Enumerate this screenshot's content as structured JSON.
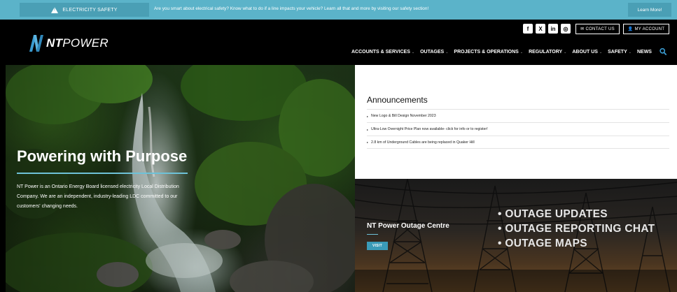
{
  "alert": {
    "label": "ELECTRICITY SAFETY",
    "message": "Are you smart about electrical safety? Know what to do if a line impacts your vehicle? Learn all that and more by visiting our safety section!",
    "button": "Learn More!"
  },
  "logo": {
    "n": "N",
    "bold": "NT",
    "light": "POWER"
  },
  "header": {
    "socials": [
      "facebook-icon",
      "x-twitter-icon",
      "linkedin-icon",
      "instagram-icon"
    ],
    "contact_label": "CONTACT US",
    "account_label": "MY ACCOUNT"
  },
  "nav": {
    "items": [
      {
        "label": "ACCOUNTS & SERVICES",
        "dropdown": true
      },
      {
        "label": "OUTAGES",
        "dropdown": true
      },
      {
        "label": "PROJECTS & OPERATIONS",
        "dropdown": true
      },
      {
        "label": "REGULATORY",
        "dropdown": true
      },
      {
        "label": "ABOUT US",
        "dropdown": true
      },
      {
        "label": "SAFETY",
        "dropdown": true
      },
      {
        "label": "NEWS",
        "dropdown": false
      }
    ],
    "chevron": "⌄"
  },
  "hero": {
    "title": "Powering with Purpose",
    "text": "NT Power is an Ontario Energy Board licensed electricity Local Distribution Company. We are an independent, industry-leading LDC committed to our customers' changing needs."
  },
  "announcements": {
    "title": "Announcements",
    "items": [
      "New Logo & Bill Design November 2023",
      "Ultra-Low Overnight Price Plan now available- click for info or to register!",
      "2.8 km of Underground Cables are being replaced in Quaker Hill"
    ]
  },
  "outage": {
    "title": "NT Power Outage Centre",
    "button": "VISIT",
    "list": [
      "• OUTAGE UPDATES",
      "• OUTAGE REPORTING CHAT",
      "• OUTAGE MAPS"
    ]
  },
  "colors": {
    "accent": "#5bb3c9",
    "accent_dark": "#4a9fb5",
    "logo_blue": "#3a9bd0"
  }
}
